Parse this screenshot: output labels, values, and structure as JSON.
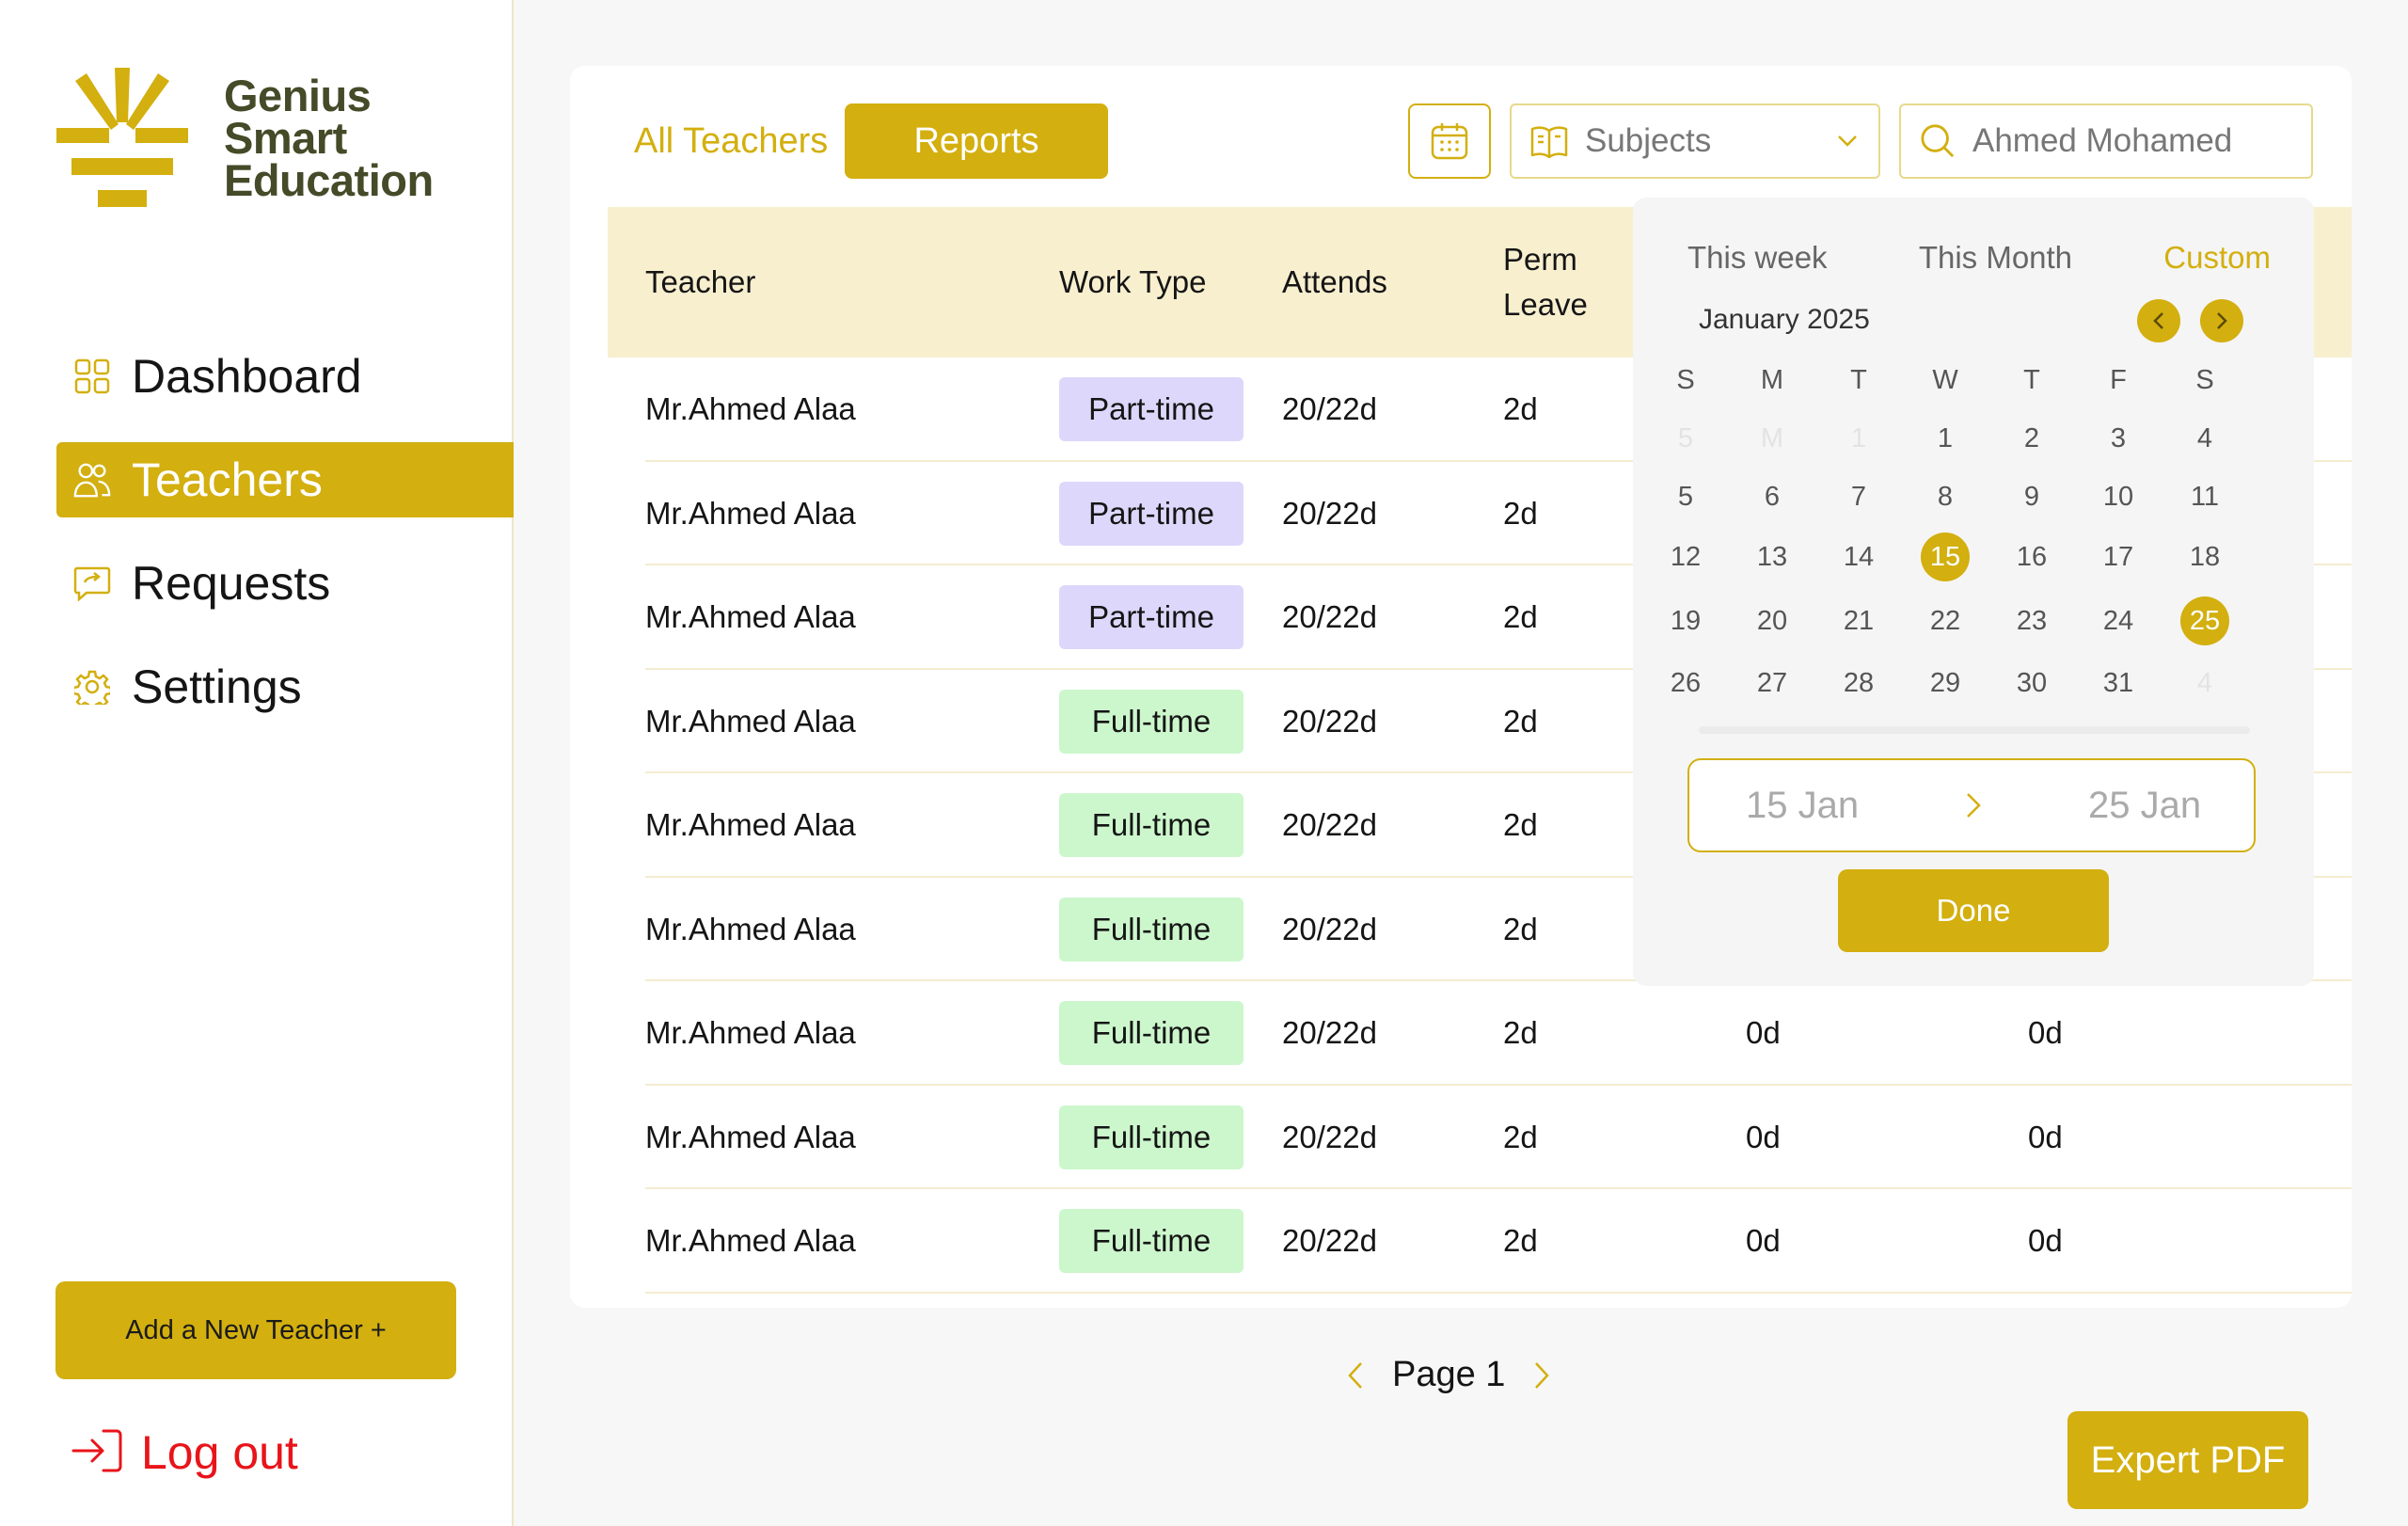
{
  "brand": {
    "line1": "Genius",
    "line2": "Smart",
    "line3": "Education"
  },
  "nav": [
    {
      "label": "Dashboard",
      "icon": "dashboard-icon"
    },
    {
      "label": "Teachers",
      "icon": "teachers-icon",
      "active": true
    },
    {
      "label": "Requests",
      "icon": "requests-icon"
    },
    {
      "label": "Settings",
      "icon": "gear-icon"
    }
  ],
  "sidebar": {
    "add_teacher": "Add a New Teacher +",
    "logout": "Log out"
  },
  "tabs": {
    "all": "All Teachers",
    "reports": "Reports"
  },
  "filters": {
    "subjects": "Subjects",
    "search_value": "Ahmed Mohamed"
  },
  "table": {
    "headers": {
      "teacher": "Teacher",
      "work_type": "Work Type",
      "attends": "Attends",
      "perm_line1": "Perm",
      "perm_line2": "Leave"
    },
    "rows": [
      {
        "name": "Mr.Ahmed Alaa",
        "type": "Part-time",
        "kind": "part",
        "attends": "20/22d",
        "perm": "2d",
        "col5": "",
        "col6": ""
      },
      {
        "name": "Mr.Ahmed Alaa",
        "type": "Part-time",
        "kind": "part",
        "attends": "20/22d",
        "perm": "2d",
        "col5": "",
        "col6": ""
      },
      {
        "name": "Mr.Ahmed Alaa",
        "type": "Part-time",
        "kind": "part",
        "attends": "20/22d",
        "perm": "2d",
        "col5": "",
        "col6": ""
      },
      {
        "name": "Mr.Ahmed Alaa",
        "type": "Full-time",
        "kind": "full",
        "attends": "20/22d",
        "perm": "2d",
        "col5": "",
        "col6": ""
      },
      {
        "name": "Mr.Ahmed Alaa",
        "type": "Full-time",
        "kind": "full",
        "attends": "20/22d",
        "perm": "2d",
        "col5": "",
        "col6": ""
      },
      {
        "name": "Mr.Ahmed Alaa",
        "type": "Full-time",
        "kind": "full",
        "attends": "20/22d",
        "perm": "2d",
        "col5": "",
        "col6": ""
      },
      {
        "name": "Mr.Ahmed Alaa",
        "type": "Full-time",
        "kind": "full",
        "attends": "20/22d",
        "perm": "2d",
        "col5": "0d",
        "col6": "0d"
      },
      {
        "name": "Mr.Ahmed Alaa",
        "type": "Full-time",
        "kind": "full",
        "attends": "20/22d",
        "perm": "2d",
        "col5": "0d",
        "col6": "0d"
      },
      {
        "name": "Mr.Ahmed Alaa",
        "type": "Full-time",
        "kind": "full",
        "attends": "20/22d",
        "perm": "2d",
        "col5": "0d",
        "col6": "0d"
      }
    ]
  },
  "pagination": {
    "label": "Page 1"
  },
  "export": {
    "label": "Expert PDF"
  },
  "datepicker": {
    "ranges": [
      {
        "label": "This week"
      },
      {
        "label": "This Month"
      },
      {
        "label": "Custom",
        "active": true
      }
    ],
    "month": "January 2025",
    "weekdays": [
      "S",
      "M",
      "T",
      "W",
      "T",
      "F",
      "S"
    ],
    "weeks": [
      [
        {
          "d": "5",
          "muted": true
        },
        {
          "d": "M",
          "muted": true
        },
        {
          "d": "1",
          "muted": true
        },
        {
          "d": "1"
        },
        {
          "d": "2"
        },
        {
          "d": "3"
        },
        {
          "d": "4"
        }
      ],
      [
        {
          "d": "5"
        },
        {
          "d": "6"
        },
        {
          "d": "7"
        },
        {
          "d": "8"
        },
        {
          "d": "9"
        },
        {
          "d": "10"
        },
        {
          "d": "11"
        }
      ],
      [
        {
          "d": "12"
        },
        {
          "d": "13"
        },
        {
          "d": "14"
        },
        {
          "d": "15",
          "selected": true
        },
        {
          "d": "16"
        },
        {
          "d": "17"
        },
        {
          "d": "18"
        }
      ],
      [
        {
          "d": "19"
        },
        {
          "d": "20"
        },
        {
          "d": "21"
        },
        {
          "d": "22"
        },
        {
          "d": "23"
        },
        {
          "d": "24"
        },
        {
          "d": "25",
          "selected": true
        }
      ],
      [
        {
          "d": "26"
        },
        {
          "d": "27"
        },
        {
          "d": "28"
        },
        {
          "d": "29"
        },
        {
          "d": "30"
        },
        {
          "d": "31"
        },
        {
          "d": "4",
          "muted": true
        }
      ]
    ],
    "start": "15 Jan",
    "end": "25 Jan",
    "done": "Done"
  },
  "colors": {
    "accent": "#d3af0f",
    "header_bg": "#f8efcf",
    "part_time": "#ddd7fb",
    "full_time": "#ccf7cc",
    "logout": "#e8141a"
  }
}
